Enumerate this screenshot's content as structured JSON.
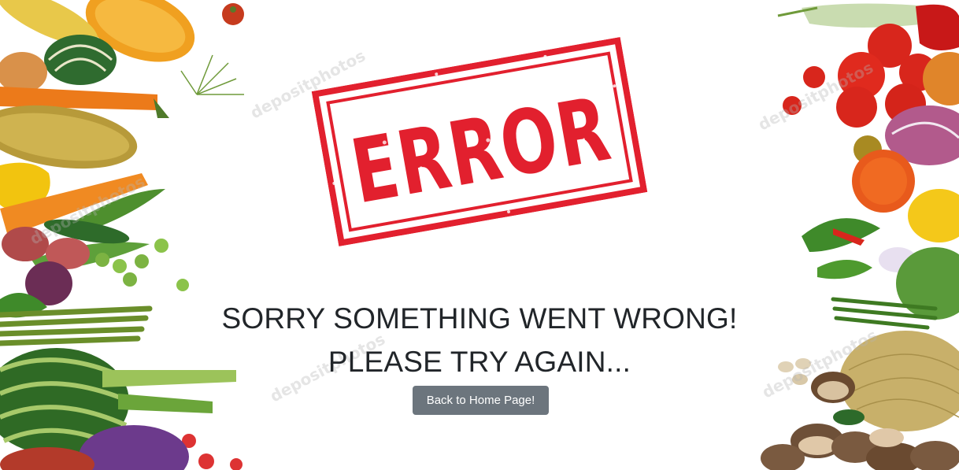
{
  "stamp": {
    "text": "ERROR",
    "color": "#e2202e"
  },
  "message": {
    "line1": "SORRY SOMETHING WENT WRONG!",
    "line2": "PLEASE TRY AGAIN..."
  },
  "button": {
    "label": "Back to Home Page!",
    "color": "#6c757d"
  },
  "background": {
    "left_image": "vegetables-border-left",
    "right_image": "vegetables-border-right",
    "watermark": "depositphotos"
  }
}
